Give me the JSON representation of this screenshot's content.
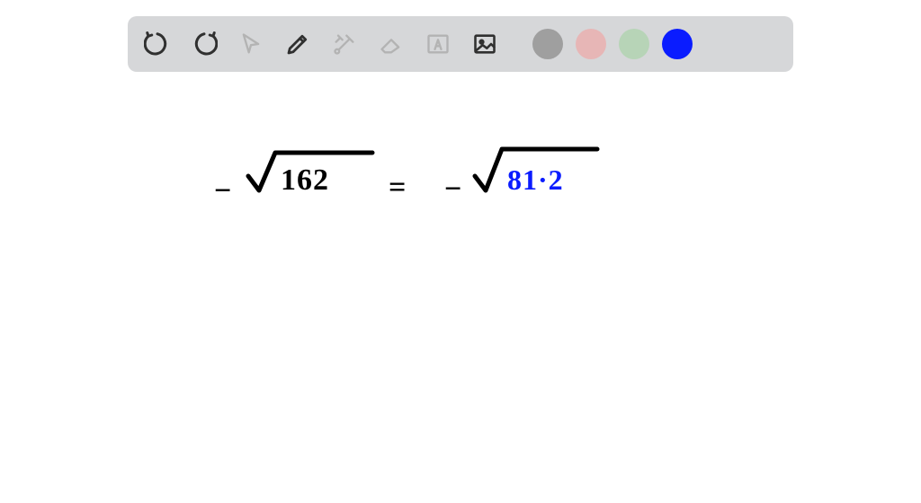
{
  "toolbar": {
    "tools": {
      "undo": "undo-icon",
      "redo": "redo-icon",
      "pointer": "cursor-icon",
      "pen": "pen-icon",
      "tools_menu": "tools-icon",
      "eraser": "eraser-icon",
      "text_box": "text-box-icon",
      "image": "image-icon"
    },
    "swatches": [
      {
        "name": "color-gray",
        "hex": "#9f9f9f"
      },
      {
        "name": "color-pink",
        "hex": "#e7b6b6"
      },
      {
        "name": "color-green",
        "hex": "#b7d4b7"
      },
      {
        "name": "color-blue",
        "hex": "#0a1cff"
      }
    ],
    "active_color": "#0a1cff",
    "disabled_stroke": "#b3b3b3",
    "icon_stroke": "#303030"
  },
  "canvas": {
    "equation": {
      "left_minus": "−",
      "left_radicand": "162",
      "equals": "=",
      "right_minus": "−",
      "right_radicand": "81·2"
    },
    "ink_black": "#000000",
    "ink_blue": "#0a1cff"
  }
}
